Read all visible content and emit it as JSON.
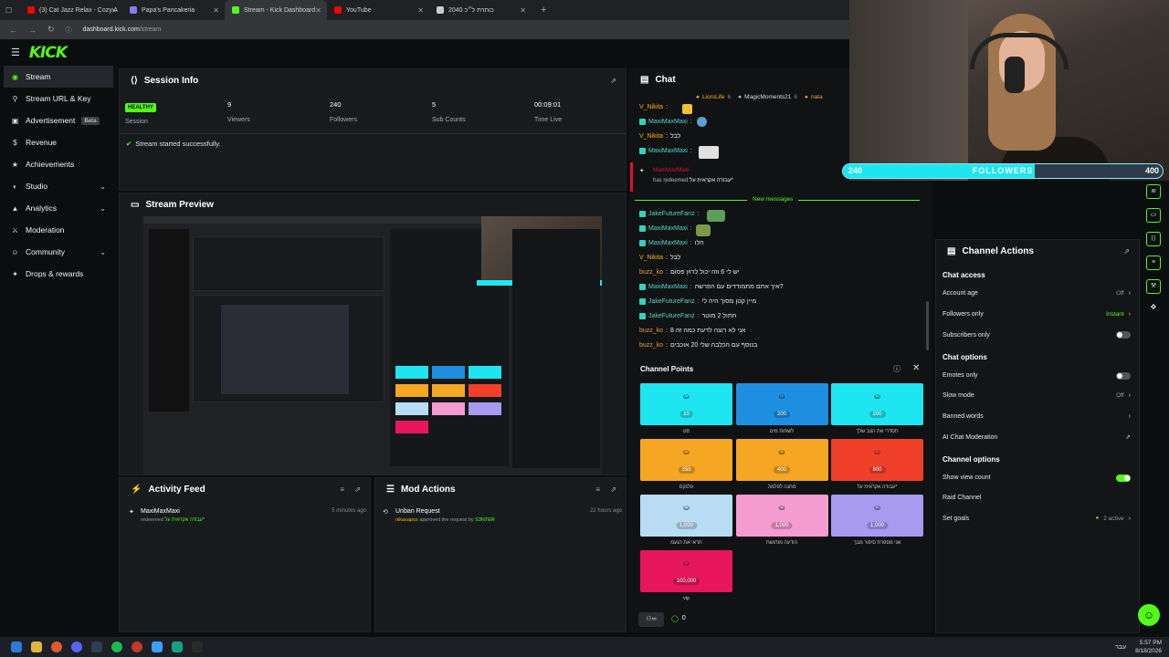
{
  "browser": {
    "tabs": [
      {
        "label": "(3) Cat Jazz Relax - Cozy A",
        "color": "#ff0000",
        "active": false
      },
      {
        "label": "Papa's Pancakeria",
        "color": "#8a7cf0",
        "active": false
      },
      {
        "label": "Stream - Kick Dashboard",
        "color": "#53fc18",
        "active": true
      },
      {
        "label": "YouTube",
        "color": "#ff0000",
        "active": false
      },
      {
        "label": "2040 כותרת ל״כ",
        "color": "#cccccc",
        "active": false
      }
    ],
    "url_host": "dashboard.kick.com",
    "url_path": "/stream"
  },
  "brand": {
    "logo": "KICK",
    "accent": "#53fc18"
  },
  "sidebar": {
    "items": [
      {
        "label": "Stream",
        "icon": "broadcast-icon",
        "glyph": "◉",
        "active": true,
        "chevron": false
      },
      {
        "label": "Stream URL & Key",
        "icon": "link-icon",
        "glyph": "⚲",
        "active": false,
        "chevron": false
      },
      {
        "label": "Advertisement",
        "icon": "ad-icon",
        "glyph": "▣",
        "active": false,
        "chevron": false,
        "badge": "Beta"
      },
      {
        "label": "Revenue",
        "icon": "dollar-icon",
        "glyph": "$",
        "active": false,
        "chevron": false
      },
      {
        "label": "Achievements",
        "icon": "trophy-icon",
        "glyph": "★",
        "active": false,
        "chevron": false
      },
      {
        "label": "Studio",
        "icon": "studio-icon",
        "glyph": "◐",
        "active": false,
        "chevron": true
      },
      {
        "label": "Analytics",
        "icon": "chart-icon",
        "glyph": "▲",
        "active": false,
        "chevron": true
      },
      {
        "label": "Moderation",
        "icon": "sword-icon",
        "glyph": "⚔",
        "active": false,
        "chevron": false
      },
      {
        "label": "Community",
        "icon": "people-icon",
        "glyph": "☺",
        "active": false,
        "chevron": true
      },
      {
        "label": "Drops & rewards",
        "icon": "gift-icon",
        "glyph": "✦",
        "active": false,
        "chevron": false
      }
    ]
  },
  "session": {
    "title": "Session Info",
    "health": "HEALTHY",
    "stats": [
      {
        "value": "",
        "label": "Session"
      },
      {
        "value": "9",
        "label": "Viewers"
      },
      {
        "value": "240",
        "label": "Followers"
      },
      {
        "value": "5",
        "label": "Sub Counts"
      },
      {
        "value": "00:09:01",
        "label": "Time Live"
      }
    ],
    "status_msg": "Stream started successfully."
  },
  "preview": {
    "title": "Stream Preview"
  },
  "activity": {
    "title": "Activity Feed",
    "item_user": "MaxiMaxMaxi",
    "item_text": "redeemed",
    "item_reward": "עבודה אקראית על*",
    "item_time": "5 minutes ago"
  },
  "mod": {
    "title": "Mod Actions",
    "item_title": "Unban Request",
    "item_user": "nikasapoz",
    "item_text": "approved the request by",
    "item_target": "S3NTER",
    "item_time": "22 hours ago"
  },
  "chat": {
    "title": "Chat",
    "top_chatters": [
      {
        "name": "LiorsLife",
        "count": "6"
      },
      {
        "name": "MagicMoments21",
        "count": "6"
      },
      {
        "name": "nata",
        "count": ""
      }
    ],
    "messages_top": [
      {
        "user": "V_Nikita",
        "text": "",
        "cls": "u2"
      },
      {
        "user": "MaxiMaxMaxi",
        "text": "",
        "cls": "u1"
      },
      {
        "user": "V_Nikita",
        "text": "לבל",
        "cls": "u2"
      },
      {
        "user": "MaxiMaxMaxi",
        "text": "",
        "cls": "u1"
      }
    ],
    "redeem_user": "MaxiMaxMaxi",
    "redeem_text": "has redeemed",
    "redeem_reward": "עבודה אקראית על*",
    "new_messages": "New messages",
    "messages": [
      {
        "user": "JakeFutureFanz",
        "text": "",
        "cls": "u1"
      },
      {
        "user": "MaxiMaxMaxi",
        "text": "",
        "cls": "u1"
      },
      {
        "user": "MaxiMaxMaxi",
        "text": "הלו",
        "cls": "u1"
      },
      {
        "user": "V_Nikita",
        "text": "לבל",
        "cls": "u2"
      },
      {
        "user": "buzz_ko",
        "text": "יש לי 6 וזה יכול לרוץ פסום",
        "cls": "u4"
      },
      {
        "user": "MaxiMaxMaxi",
        "text": "איך אתם מתמודדים עם הפרשה?",
        "cls": "u1"
      },
      {
        "user": "JakeFutureFanz",
        "text": "מיין קטן מסוך היה לי",
        "cls": "u1"
      },
      {
        "user": "JakeFutureFanz",
        "text": "חתול 2 מוטר",
        "cls": "u1"
      },
      {
        "user": "buzz_ko",
        "text": "אני לא רוצה לדעת כמה זה 8",
        "cls": "u4"
      },
      {
        "user": "buzz_ko",
        "text": "בנוסף עם הכלבה שלי 20 אוכבים",
        "cls": "u4"
      }
    ],
    "points_count": "0"
  },
  "channel_points": {
    "title": "Channel Points",
    "rewards": [
      {
        "cost": "10",
        "label": "סט",
        "color": "#1ee6f0"
      },
      {
        "cost": "200",
        "label": "לשתות מים",
        "color": "#1e8fe0"
      },
      {
        "cost": "200",
        "label": "תסדרי את הצב שלך",
        "color": "#1ee6f0"
      },
      {
        "cost": "350",
        "label": "פלנקס",
        "color": "#f5a623"
      },
      {
        "cost": "400",
        "label": "מתנה לפלמה",
        "color": "#f5a623"
      },
      {
        "cost": "800",
        "label": "עבודה אקראית על*",
        "color": "#f0402a"
      },
      {
        "cost": "1,000",
        "label": "תראי את הנעמ",
        "color": "#b9dcf5"
      },
      {
        "cost": "1,000",
        "label": "הודעה מודגשת",
        "color": "#f49bd0"
      },
      {
        "cost": "1,000",
        "label": "אני מספרת סיפור מבך",
        "color": "#a89af0"
      },
      {
        "cost": "100,000",
        "label": "vip",
        "color": "#e8175d"
      }
    ]
  },
  "overlay": {
    "followers_current": "240",
    "followers_label": "FOLLOWERS",
    "followers_goal": "400",
    "progress": 0.6
  },
  "channel_actions": {
    "title": "Channel Actions",
    "sections": [
      {
        "heading": "Chat access",
        "rows": [
          {
            "label": "Account age",
            "value": "Off",
            "type": "arrow"
          },
          {
            "label": "Followers only",
            "value": "Instant",
            "type": "arrow",
            "accent": true
          },
          {
            "label": "Subscribers only",
            "value": "",
            "type": "toggle",
            "on": false
          }
        ]
      },
      {
        "heading": "Chat options",
        "rows": [
          {
            "label": "Emotes only",
            "value": "",
            "type": "toggle",
            "on": false
          },
          {
            "label": "Slow mode",
            "value": "Off",
            "type": "arrow"
          },
          {
            "label": "Banned words",
            "value": "",
            "type": "arrow"
          },
          {
            "label": "AI Chat Moderation",
            "value": "",
            "type": "external"
          }
        ]
      },
      {
        "heading": "Channel options",
        "rows": [
          {
            "label": "Show view count",
            "value": "",
            "type": "toggle",
            "on": true
          },
          {
            "label": "Raid Channel",
            "value": "",
            "type": "none"
          },
          {
            "label": "Set goals",
            "value": "2 active",
            "type": "arrow"
          }
        ]
      }
    ]
  },
  "taskbar": {
    "lang": "עבר",
    "time": "5:57 PM",
    "date": "8/18/2026"
  }
}
